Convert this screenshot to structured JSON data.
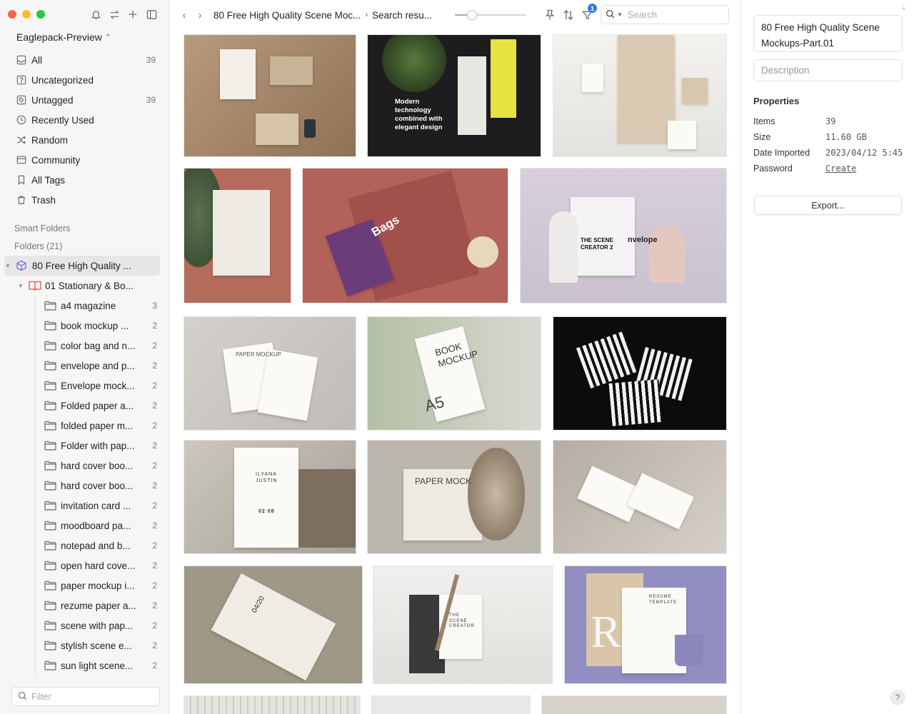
{
  "library": {
    "name": "Eaglepack-Preview"
  },
  "nav": [
    {
      "label": "All",
      "count": "39"
    },
    {
      "label": "Uncategorized",
      "count": ""
    },
    {
      "label": "Untagged",
      "count": "39"
    },
    {
      "label": "Recently Used",
      "count": ""
    },
    {
      "label": "Random",
      "count": ""
    },
    {
      "label": "Community",
      "count": ""
    },
    {
      "label": "All Tags",
      "count": ""
    },
    {
      "label": "Trash",
      "count": ""
    }
  ],
  "sections": {
    "smart_folders": "Smart Folders",
    "folders": "Folders (21)"
  },
  "tree": {
    "root": {
      "label": "80 Free High Quality ..."
    },
    "group": {
      "label": "01 Stationary & Bo..."
    },
    "folders": [
      {
        "label": "a4 magazine",
        "count": "3"
      },
      {
        "label": "book mockup ...",
        "count": "2"
      },
      {
        "label": "color bag and n...",
        "count": "2"
      },
      {
        "label": "envelope and p...",
        "count": "2"
      },
      {
        "label": "Envelope mock...",
        "count": "2"
      },
      {
        "label": "Folded paper a...",
        "count": "2"
      },
      {
        "label": "folded paper m...",
        "count": "2"
      },
      {
        "label": "Folder with pap...",
        "count": "2"
      },
      {
        "label": "hard cover boo...",
        "count": "2"
      },
      {
        "label": "hard cover boo...",
        "count": "2"
      },
      {
        "label": "invitation card ...",
        "count": "2"
      },
      {
        "label": "moodboard pa...",
        "count": "2"
      },
      {
        "label": "notepad and b...",
        "count": "2"
      },
      {
        "label": "open hard cove...",
        "count": "2"
      },
      {
        "label": "paper mockup i...",
        "count": "2"
      },
      {
        "label": "rezume paper a...",
        "count": "2"
      },
      {
        "label": "scene with pap...",
        "count": "2"
      },
      {
        "label": "stylish scene e...",
        "count": "2"
      },
      {
        "label": "sun light scene...",
        "count": "2"
      }
    ]
  },
  "filter": {
    "placeholder": "Filter"
  },
  "toolbar": {
    "breadcrumb_1": "80 Free High Quality Scene Moc...",
    "breadcrumb_2": "Search resu...",
    "zoom_level": 0.2,
    "filter_badge": "1"
  },
  "search": {
    "placeholder": "Search"
  },
  "thumbnails": {
    "t2_text": "Modern technology combined with elegant design",
    "t5_text": "Bags",
    "t6_text": "THE SCENE CREATOR 2",
    "t6_text2": "nvelope",
    "t7_text": "PAPER MOCKUP",
    "t8_text": "BOOK MOCKUP",
    "t8_text2": "A5",
    "t10_text": "ILYANA JUSTIN",
    "t10_text2": "02 08",
    "t11_text": "PAPER MOCK",
    "t13_text": "04/20",
    "t14_text": "THE SCENE CREATOR",
    "t15_text": "RESUME TEMPLATE",
    "t15_text2": "R"
  },
  "inspector": {
    "name": "80 Free High Quality Scene Mockups-Part.01",
    "description_placeholder": "Description",
    "properties_title": "Properties",
    "properties": [
      {
        "key": "Items",
        "value": "39"
      },
      {
        "key": "Size",
        "value": "11.60 GB"
      },
      {
        "key": "Date Imported",
        "value": "2023/04/12 5:45"
      },
      {
        "key": "Password",
        "value": "Create"
      }
    ],
    "export_label": "Export...",
    "help_label": "?"
  },
  "colors": {
    "accent": "#2f7de1",
    "sidebar_bg": "#f6f6f6",
    "selected_row": "#e6e6e9",
    "folder_group_icon": "#d9534f",
    "root_icon": "#7b6fd6"
  }
}
